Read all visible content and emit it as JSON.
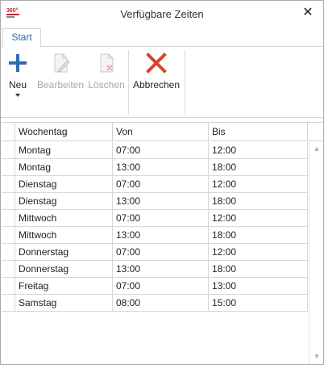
{
  "window": {
    "title": "Verfügbare Zeiten",
    "app_icon_text": "360°",
    "close_glyph": "✕"
  },
  "ribbon": {
    "tabs": [
      {
        "label": "Start",
        "selected": true
      }
    ],
    "buttons": {
      "new": {
        "label": "Neu",
        "icon": "plus-icon",
        "enabled": true
      },
      "edit": {
        "label": "Bearbeiten",
        "icon": "edit-document-icon",
        "enabled": false
      },
      "delete": {
        "label": "Löschen",
        "icon": "delete-document-icon",
        "enabled": false
      },
      "cancel": {
        "label": "Abbrechen",
        "icon": "cancel-x-icon",
        "enabled": true
      }
    }
  },
  "colors": {
    "accent_blue": "#2b6cb5",
    "cancel_red": "#d9432d",
    "plus_blue": "#2f6db3"
  },
  "grid": {
    "columns": [
      "Wochentag",
      "Von",
      "Bis"
    ],
    "rows": [
      {
        "day": "Montag",
        "from": "07:00",
        "to": "12:00"
      },
      {
        "day": "Montag",
        "from": "13:00",
        "to": "18:00"
      },
      {
        "day": "Dienstag",
        "from": "07:00",
        "to": "12:00"
      },
      {
        "day": "Dienstag",
        "from": "13:00",
        "to": "18:00"
      },
      {
        "day": "Mittwoch",
        "from": "07:00",
        "to": "12:00"
      },
      {
        "day": "Mittwoch",
        "from": "13:00",
        "to": "18:00"
      },
      {
        "day": "Donnerstag",
        "from": "07:00",
        "to": "12:00"
      },
      {
        "day": "Donnerstag",
        "from": "13:00",
        "to": "18:00"
      },
      {
        "day": "Freitag",
        "from": "07:00",
        "to": "13:00"
      },
      {
        "day": "Samstag",
        "from": "08:00",
        "to": "15:00"
      }
    ]
  }
}
